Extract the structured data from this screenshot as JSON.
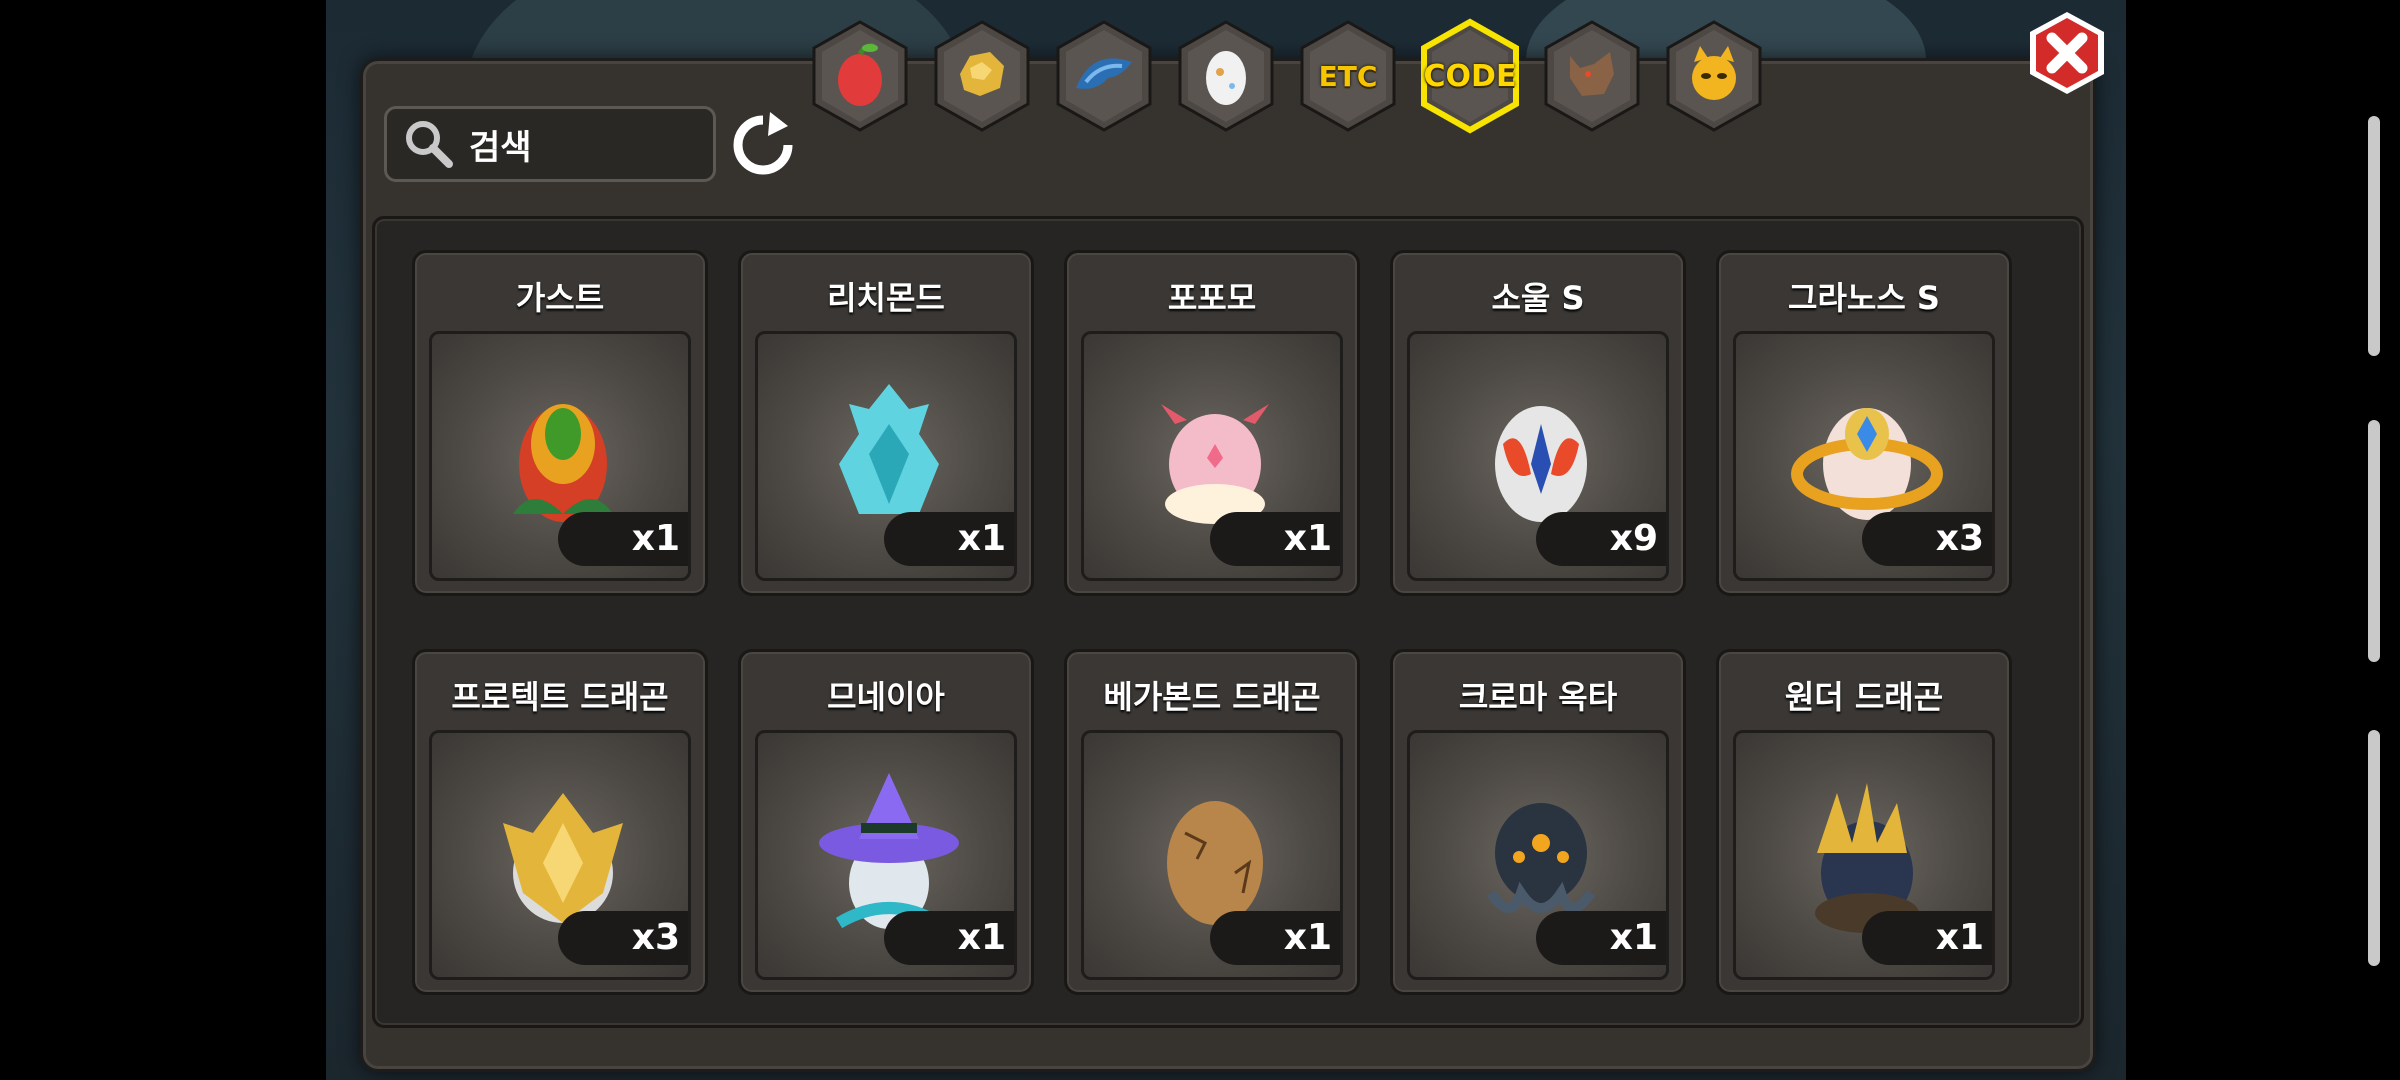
{
  "search": {
    "placeholder": "검색"
  },
  "tabs": [
    {
      "name": "tab-fruit",
      "icon": "red-fruit-icon",
      "label": ""
    },
    {
      "name": "tab-gold",
      "icon": "gold-nugget-icon",
      "label": ""
    },
    {
      "name": "tab-scale",
      "icon": "blue-scale-icon",
      "label": ""
    },
    {
      "name": "tab-egg",
      "icon": "egg-icon",
      "label": ""
    },
    {
      "name": "tab-etc",
      "icon": "etc-label-icon",
      "label": "ETC"
    },
    {
      "name": "tab-code",
      "icon": "code-label-icon",
      "label": "CODE",
      "active": true
    },
    {
      "name": "tab-wolf",
      "icon": "wolf-head-icon",
      "label": ""
    },
    {
      "name": "tab-devil",
      "icon": "yellow-devil-icon",
      "label": ""
    }
  ],
  "items": [
    {
      "name": "가스트",
      "qty": "x1",
      "egg": "leaf-egg"
    },
    {
      "name": "리치몬드",
      "qty": "x1",
      "egg": "crystal-egg"
    },
    {
      "name": "포포모",
      "qty": "x1",
      "egg": "pink-dragon-egg"
    },
    {
      "name": "소울 S",
      "qty": "x9",
      "egg": "soul-egg"
    },
    {
      "name": "그라노스 S",
      "qty": "x3",
      "egg": "golden-ring-egg"
    },
    {
      "name": "프로텍트 드래곤",
      "qty": "x3",
      "egg": "golden-shield-egg"
    },
    {
      "name": "므네이아",
      "qty": "x1",
      "egg": "witch-hat-egg"
    },
    {
      "name": "베가본드 드래곤",
      "qty": "x1",
      "egg": "cracked-brown-egg"
    },
    {
      "name": "크로마 옥타",
      "qty": "x1",
      "egg": "octopus-egg"
    },
    {
      "name": "원더 드래곤",
      "qty": "x1",
      "egg": "spiky-gold-egg"
    }
  ],
  "colors": {
    "panel": "#36332f",
    "accent": "#f7c400",
    "close": "#d32a2a"
  }
}
